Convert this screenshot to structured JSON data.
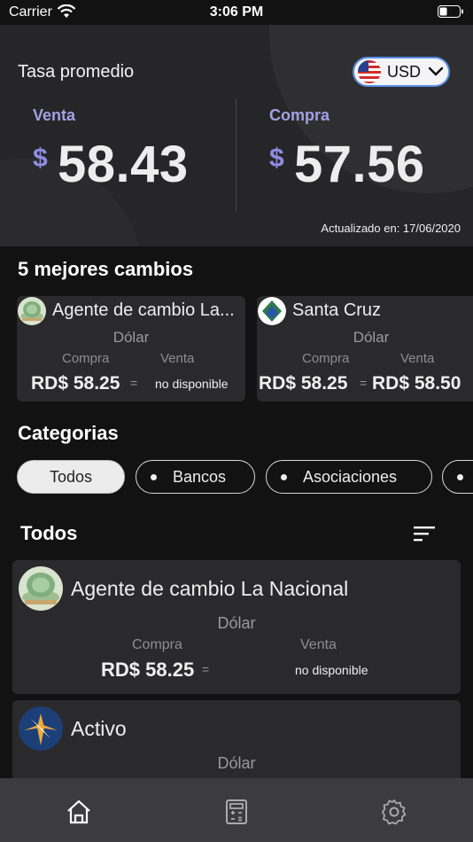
{
  "status_bar": {
    "carrier": "Carrier",
    "time": "3:06 PM"
  },
  "hero": {
    "average_label": "Tasa promedio",
    "currency": {
      "code": "USD",
      "flag": "us-flag-icon"
    },
    "sell": {
      "label": "Venta",
      "symbol": "$",
      "amount": "58.43"
    },
    "buy": {
      "label": "Compra",
      "symbol": "$",
      "amount": "57.56"
    },
    "updated": "Actualizado en: 17/06/2020"
  },
  "top_exchanges": {
    "title": "5 mejores cambios",
    "cards": [
      {
        "name": "Agente de cambio La...",
        "logo": "coins-logo",
        "currency": "Dólar",
        "buy_label": "Compra",
        "sell_label": "Venta",
        "buy_value": "RD$ 58.25",
        "buy_trend": "=",
        "sell_value": "no disponible"
      },
      {
        "name": "Santa Cruz",
        "logo": "santa-cruz-logo",
        "currency": "Dólar",
        "buy_label": "Compra",
        "sell_label": "Venta",
        "buy_value": "RD$ 58.25",
        "buy_trend": "=",
        "sell_value": "RD$ 58.50"
      }
    ]
  },
  "categories": {
    "title": "Categorias",
    "chips": [
      "Todos",
      "Bancos",
      "Asociaciones"
    ]
  },
  "list": {
    "title": "Todos",
    "items": [
      {
        "name": "Agente de cambio La Nacional",
        "logo": "coins-logo",
        "currency": "Dólar",
        "buy_label": "Compra",
        "sell_label": "Venta",
        "buy_value": "RD$ 58.25",
        "buy_trend": "=",
        "sell_value": "no disponible"
      },
      {
        "name": "Activo",
        "logo": "activo-logo",
        "currency": "Dólar"
      }
    ]
  },
  "tab_bar": {
    "tabs": [
      "home-icon",
      "calculator-icon",
      "settings-icon"
    ]
  },
  "colors": {
    "accent": "#8e8ce0",
    "background": "#121212",
    "card": "#2a2a2c",
    "tab_bar": "#3c3c3e"
  }
}
